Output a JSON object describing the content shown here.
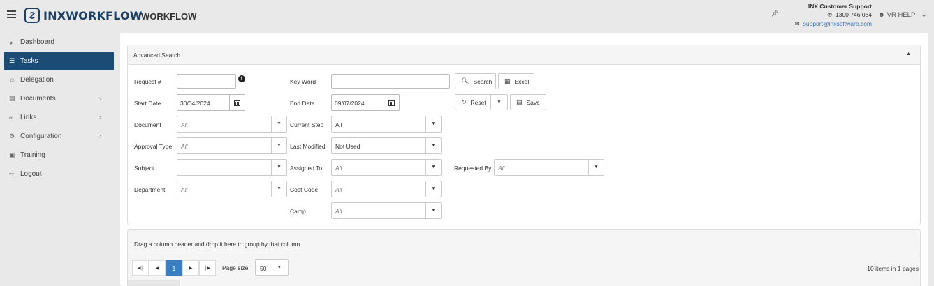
{
  "header": {
    "logo_text": "INXWORKFLOW",
    "app_title": "WORKFLOW",
    "support_title": "INX Customer Support",
    "support_phone": "1300 746 084",
    "support_email": "support@inxsoftware.com",
    "user_menu": "VR HELP"
  },
  "sidebar": {
    "items": [
      {
        "label": "Dashboard",
        "icon": "dashboard-icon"
      },
      {
        "label": "Tasks",
        "icon": "list-icon",
        "active": true
      },
      {
        "label": "Delegation",
        "icon": "users-icon"
      },
      {
        "label": "Documents",
        "icon": "document-icon",
        "has_children": true
      },
      {
        "label": "Links",
        "icon": "link-icon",
        "has_children": true
      },
      {
        "label": "Configuration",
        "icon": "sliders-icon",
        "has_children": true
      },
      {
        "label": "Training",
        "icon": "training-icon"
      },
      {
        "label": "Logout",
        "icon": "logout-icon"
      }
    ]
  },
  "search": {
    "panel_title": "Advanced Search",
    "request_label": "Request #",
    "request_value": "",
    "keyword_label": "Key Word",
    "keyword_value": "",
    "start_date_label": "Start Date",
    "start_date": "30/04/2024",
    "end_date_label": "End Date",
    "end_date": "09/07/2024",
    "document_label": "Document",
    "document_value": "All",
    "current_step_label": "Current Step",
    "current_step_value": "All",
    "approval_type_label": "Approval Type",
    "approval_type_value": "All",
    "last_modified_label": "Last Modified",
    "last_modified_value": "Not Used",
    "subject_label": "Subject",
    "subject_value": "",
    "assigned_to_label": "Assigned To",
    "assigned_to_value": "All",
    "requested_by_label": "Requested By",
    "requested_by_value": "All",
    "department_label": "Department",
    "department_value": "All",
    "cost_code_label": "Cost Code",
    "cost_code_value": "All",
    "camp_label": "Camp",
    "camp_value": "All",
    "search_button": "Search",
    "excel_button": "Excel",
    "reset_button": "Reset",
    "save_button": "Save"
  },
  "grid": {
    "group_hint": "Drag a column header and drop it here to group by that column",
    "current_page": "1",
    "page_size_label": "Page size:",
    "page_size": "50",
    "items_info": "10 items in 1 pages"
  }
}
